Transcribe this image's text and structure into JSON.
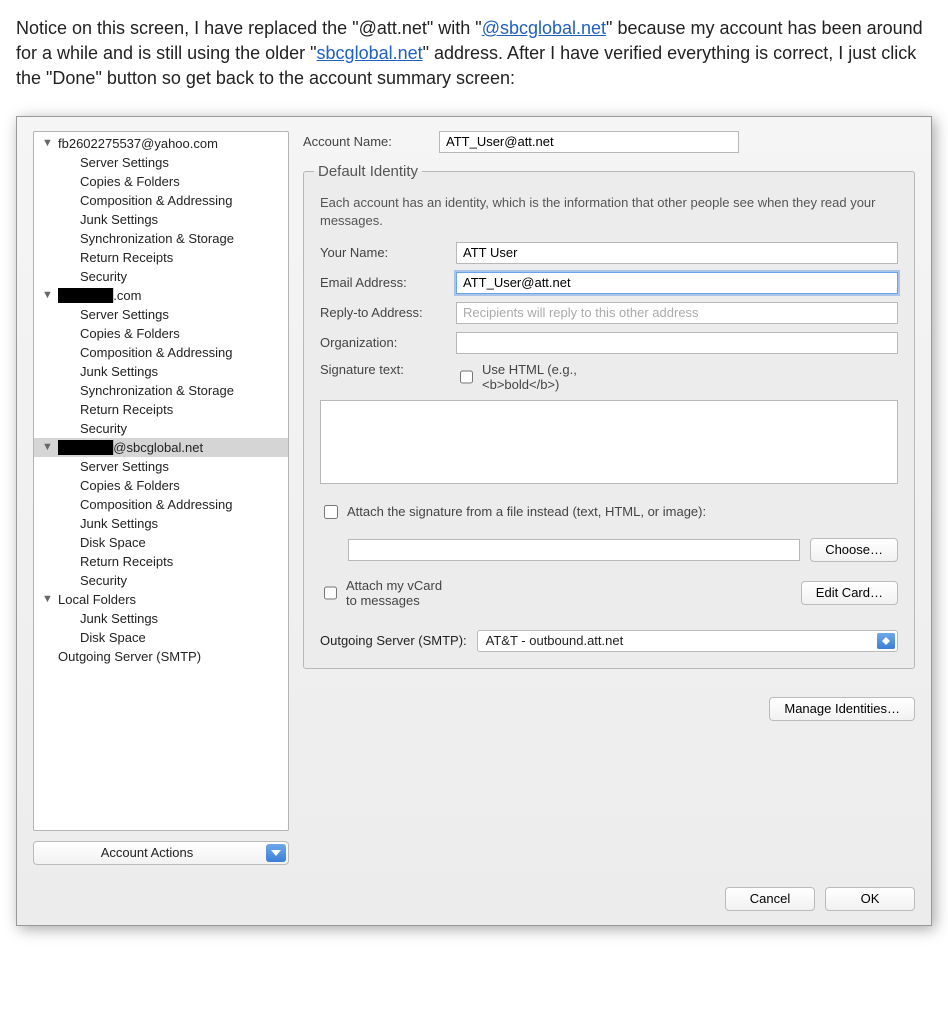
{
  "intro": {
    "text_1": "Notice on this screen, I have replaced the \"@att.net\" with \"",
    "link_1": "@sbcglobal.net",
    "text_2": "\" because my account has been around for a while and is still using the older \"",
    "link_2": "sbcglobal.net",
    "text_3": "\" address. After I have verified everything is correct, I just click the \"Done\" button so get back to the account summary screen:"
  },
  "sidebar": {
    "accounts": [
      {
        "label": "fb2602275537@yahoo.com",
        "redacted": false,
        "selected": false,
        "children": [
          "Server Settings",
          "Copies & Folders",
          "Composition & Addressing",
          "Junk Settings",
          "Synchronization & Storage",
          "Return Receipts",
          "Security"
        ]
      },
      {
        "label": ".com",
        "redacted": true,
        "selected": false,
        "children": [
          "Server Settings",
          "Copies & Folders",
          "Composition & Addressing",
          "Junk Settings",
          "Synchronization & Storage",
          "Return Receipts",
          "Security"
        ]
      },
      {
        "label": "@sbcglobal.net",
        "redacted": true,
        "selected": true,
        "children": [
          "Server Settings",
          "Copies & Folders",
          "Composition & Addressing",
          "Junk Settings",
          "Disk Space",
          "Return Receipts",
          "Security"
        ]
      },
      {
        "label": "Local Folders",
        "redacted": false,
        "selected": false,
        "children": [
          "Junk Settings",
          "Disk Space"
        ]
      }
    ],
    "outgoing_label": "Outgoing Server (SMTP)",
    "actions_label": "Account Actions"
  },
  "main": {
    "account_name_label": "Account Name:",
    "account_name_value": "ATT_User@att.net",
    "identity_legend": "Default Identity",
    "identity_hint": "Each account has an identity, which is the information that other people see when they read your messages.",
    "your_name_label": "Your Name:",
    "your_name_value": "ATT User",
    "email_label": "Email Address:",
    "email_value": "ATT_User@att.net",
    "reply_label": "Reply-to Address:",
    "reply_placeholder": "Recipients will reply to this other address",
    "org_label": "Organization:",
    "sig_label": "Signature text:",
    "use_html_label": "Use HTML (e.g., <b>bold</b>)",
    "attach_sig_label": "Attach the signature from a file instead (text, HTML, or image):",
    "choose_label": "Choose…",
    "attach_vcard_label": "Attach my vCard to messages",
    "edit_card_label": "Edit Card…",
    "smtp_label": "Outgoing Server (SMTP):",
    "smtp_value": "AT&T - outbound.att.net",
    "manage_identities_label": "Manage Identities…"
  },
  "footer": {
    "cancel": "Cancel",
    "ok": "OK"
  }
}
